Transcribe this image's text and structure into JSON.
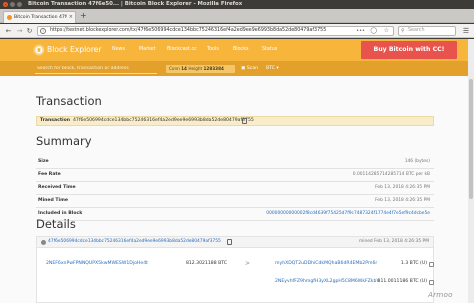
{
  "window": {
    "title": "Bitcoin Transaction 47f6e50... | Bitcoin Block Explorer - Mozilla Firefox"
  },
  "browser": {
    "tab_title": "Bitcoin Transaction 47f6e",
    "url": "https://testnet.blockexplorer.com/tx/47f6e506994cdce134bbc75246316ef4a2ed9ee9e6993b8da52de80479af3755",
    "search_placeholder": "Search"
  },
  "site": {
    "brand": "Block Explorer",
    "nav": [
      "News",
      "Market",
      "Blockcast.cc",
      "Tools",
      "Blocks",
      "Status"
    ],
    "buy_button": "Buy Bitcoin with CC!",
    "search_placeholder": "Search for block, transaction or address",
    "conn_label": "Conn",
    "conn_value": "14",
    "height_label": "Height",
    "height_value": "1283384",
    "scan_label": "Scan",
    "currency": "BTC"
  },
  "transaction": {
    "heading": "Transaction",
    "label": "Transaction",
    "txid": "47f6e506994cdce134bbc75246316ef4a2ed9ee9e6993b8da52de80479af3755"
  },
  "summary": {
    "heading": "Summary",
    "rows": [
      {
        "label": "Size",
        "value": "146 (bytes)"
      },
      {
        "label": "Fee Rate",
        "value": "0.00114285714285714 BTC per kB"
      },
      {
        "label": "Received Time",
        "value": "Feb 13, 2018 4:26:35 PM"
      },
      {
        "label": "Mined Time",
        "value": "Feb 13, 2018 4:26:35 PM"
      },
      {
        "label": "Included in Block",
        "value": "00000000000002f8cd4639f75425d7f9c7487324f1774e4f7e5ef9c4dcbe5e"
      }
    ]
  },
  "details": {
    "heading": "Details",
    "hash": "47f6e506994cdce134bbc75246316ef4a2ed9ee9e6993b8da52de80479af3755",
    "mined_time": "mined Feb 13, 2018 4:26:35 PM",
    "input": {
      "address": "2NEF6xnPwFPNNQUPX5kwMWESW1DjoHe4t",
      "value": "812.3021188 BTC"
    },
    "arrow": ">",
    "outputs": [
      {
        "address": "myhXDQT2uDDhiCdkMQhaB6dR4EMb2Pm6r",
        "value": "1.3 BTC",
        "status": "(U)"
      },
      {
        "address": "2NEyvhfFZ9hmgfH3yXL2gpH5C8M6WkFZkbY",
        "value": "811.0011186 BTC",
        "status": "(U)"
      }
    ]
  },
  "watermark": "Armoo"
}
